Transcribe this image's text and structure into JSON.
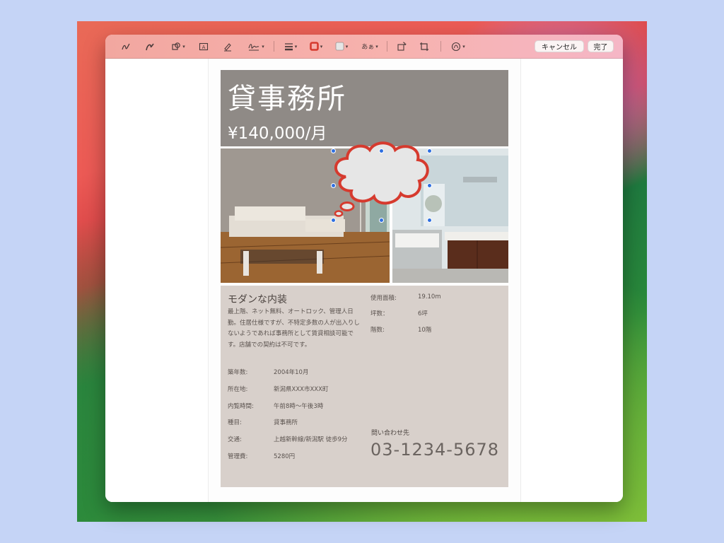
{
  "toolbar": {
    "tools": [
      {
        "icon": "sketch-icon"
      },
      {
        "icon": "draw-icon"
      },
      {
        "icon": "shapes-icon"
      },
      {
        "icon": "text-icon"
      },
      {
        "icon": "highlight-icon"
      },
      {
        "icon": "sign-icon"
      },
      {
        "icon": "shape-style-icon"
      },
      {
        "icon": "border-color-icon",
        "color": "#d63a2e"
      },
      {
        "icon": "fill-color-icon",
        "color": "#e6e6e6"
      },
      {
        "icon": "text-style-icon",
        "label": "あぁ"
      },
      {
        "icon": "rotate-icon"
      },
      {
        "icon": "crop-icon"
      },
      {
        "icon": "description-icon"
      }
    ],
    "cancel_label": "キャンセル",
    "done_label": "完了"
  },
  "flyer": {
    "title": "貸事務所",
    "price": "¥140,000/月",
    "heading": "モダンな内装",
    "description": "最上階、ネット無料、オートロック、管理人日勤。住居仕様ですが、不特定多数の人が出入りしないようであれば事務所として賃貸相談可能です。店舗での契約は不可です。",
    "specs_right": [
      {
        "label": "使用面積:",
        "value": "19.10m"
      },
      {
        "label": "坪数：",
        "value": "6坪"
      },
      {
        "label": "階数:",
        "value": "10階"
      }
    ],
    "specs_left": [
      {
        "label": "築年数:",
        "value": "2004年10月"
      },
      {
        "label": "所在地:",
        "value": "新潟県XXX市XXX町"
      },
      {
        "label": "内覧時間:",
        "value": "午前8時〜午後3時"
      },
      {
        "label": "種目:",
        "value": "貸事務所"
      },
      {
        "label": "交通:",
        "value": "上越新幹線/新潟駅 徒歩9分"
      },
      {
        "label": "管理費:",
        "value": "5280円"
      }
    ],
    "contact_label": "問い合わせ先",
    "phone": "03-1234-5678"
  },
  "annotation": {
    "shape": "thought-bubble",
    "stroke_color": "#d63a2e",
    "fill_color": "#e6e6e6"
  },
  "colors": {
    "hero_bg": "#8f8a86",
    "info_bg": "#d8d0cb",
    "toolbar_bg": "#f4aea8",
    "handle": "#2f6fe0"
  }
}
